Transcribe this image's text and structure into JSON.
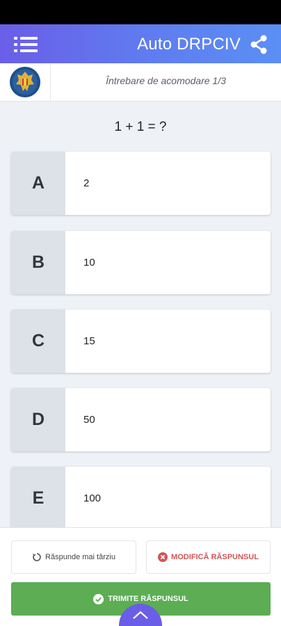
{
  "app": {
    "title": "Auto DRPCIV"
  },
  "question": {
    "counter": "Întrebare de acomodare 1/3",
    "text": "1 + 1 = ?"
  },
  "answers": [
    {
      "letter": "A",
      "text": "2"
    },
    {
      "letter": "B",
      "text": "10"
    },
    {
      "letter": "C",
      "text": "15"
    },
    {
      "letter": "D",
      "text": "50"
    },
    {
      "letter": "E",
      "text": "100"
    }
  ],
  "actions": {
    "later_label": "Răspunde mai târziu",
    "modify_label": "MODIFICĂ RĂSPUNSUL",
    "submit_label": "TRIMITE RĂSPUNSUL"
  },
  "icons": {
    "menu": "menu-icon",
    "share": "share-icon",
    "emblem": "romania-coat-of-arms",
    "later": "refresh-icon",
    "modify": "close-circle-icon",
    "submit": "check-circle-icon",
    "collapse": "chevron-up-icon"
  },
  "colors": {
    "header_start": "#6a5ee8",
    "header_end": "#5b8ff4",
    "submit": "#5cad54",
    "modify": "#d25555",
    "letter_bg": "#dde1e8",
    "page_bg": "#eef1f6"
  }
}
